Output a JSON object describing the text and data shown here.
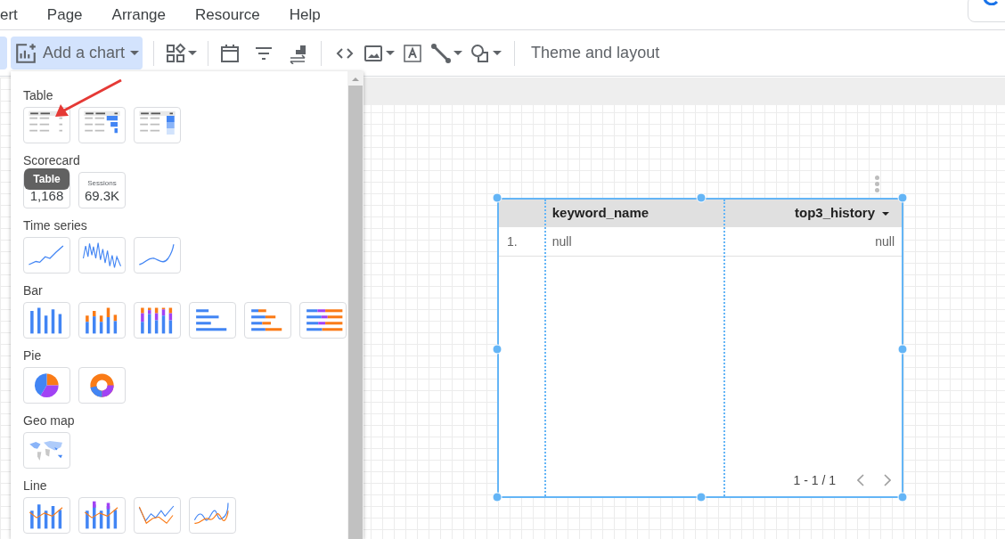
{
  "menu_bar": {
    "items": [
      "ert",
      "Page",
      "Arrange",
      "Resource",
      "Help"
    ]
  },
  "toolbar": {
    "add_chart": {
      "label": "Add a chart",
      "selected": true
    },
    "theme_button": "Theme and layout"
  },
  "chart_menu": {
    "tooltip": "Table",
    "sections": [
      {
        "title": "Table",
        "thumbnails": [
          {
            "kind": "table"
          },
          {
            "kind": "table-bars"
          },
          {
            "kind": "table-heatmap"
          }
        ]
      },
      {
        "title": "Scorecard",
        "thumbnails": [
          {
            "kind": "scorecard",
            "value": "1,168"
          },
          {
            "kind": "scorecard",
            "caption": "Sessions",
            "value": "69.3K"
          }
        ]
      },
      {
        "title": "Time series",
        "thumbnails": [
          {
            "kind": "timeseries"
          },
          {
            "kind": "sparkline"
          },
          {
            "kind": "smooth"
          }
        ]
      },
      {
        "title": "Bar",
        "thumbnails": [
          {
            "kind": "column"
          },
          {
            "kind": "column-stacked"
          },
          {
            "kind": "column-full"
          },
          {
            "kind": "bar"
          },
          {
            "kind": "bar-stacked"
          },
          {
            "kind": "bar-full"
          }
        ]
      },
      {
        "title": "Pie",
        "thumbnails": [
          {
            "kind": "pie"
          },
          {
            "kind": "donut"
          }
        ]
      },
      {
        "title": "Geo map",
        "thumbnails": [
          {
            "kind": "geo"
          }
        ]
      },
      {
        "title": "Line",
        "thumbnails": [
          {
            "kind": "combo"
          },
          {
            "kind": "combo-stacked"
          },
          {
            "kind": "line"
          },
          {
            "kind": "line-smooth"
          }
        ]
      }
    ]
  },
  "table": {
    "columns": [
      {
        "label": "keyword_name",
        "sorted": false
      },
      {
        "label": "top3_history",
        "sorted": true
      }
    ],
    "rows": [
      {
        "index": "1.",
        "cells": [
          "null",
          "null"
        ]
      }
    ],
    "pager": "1 - 1 / 1"
  }
}
